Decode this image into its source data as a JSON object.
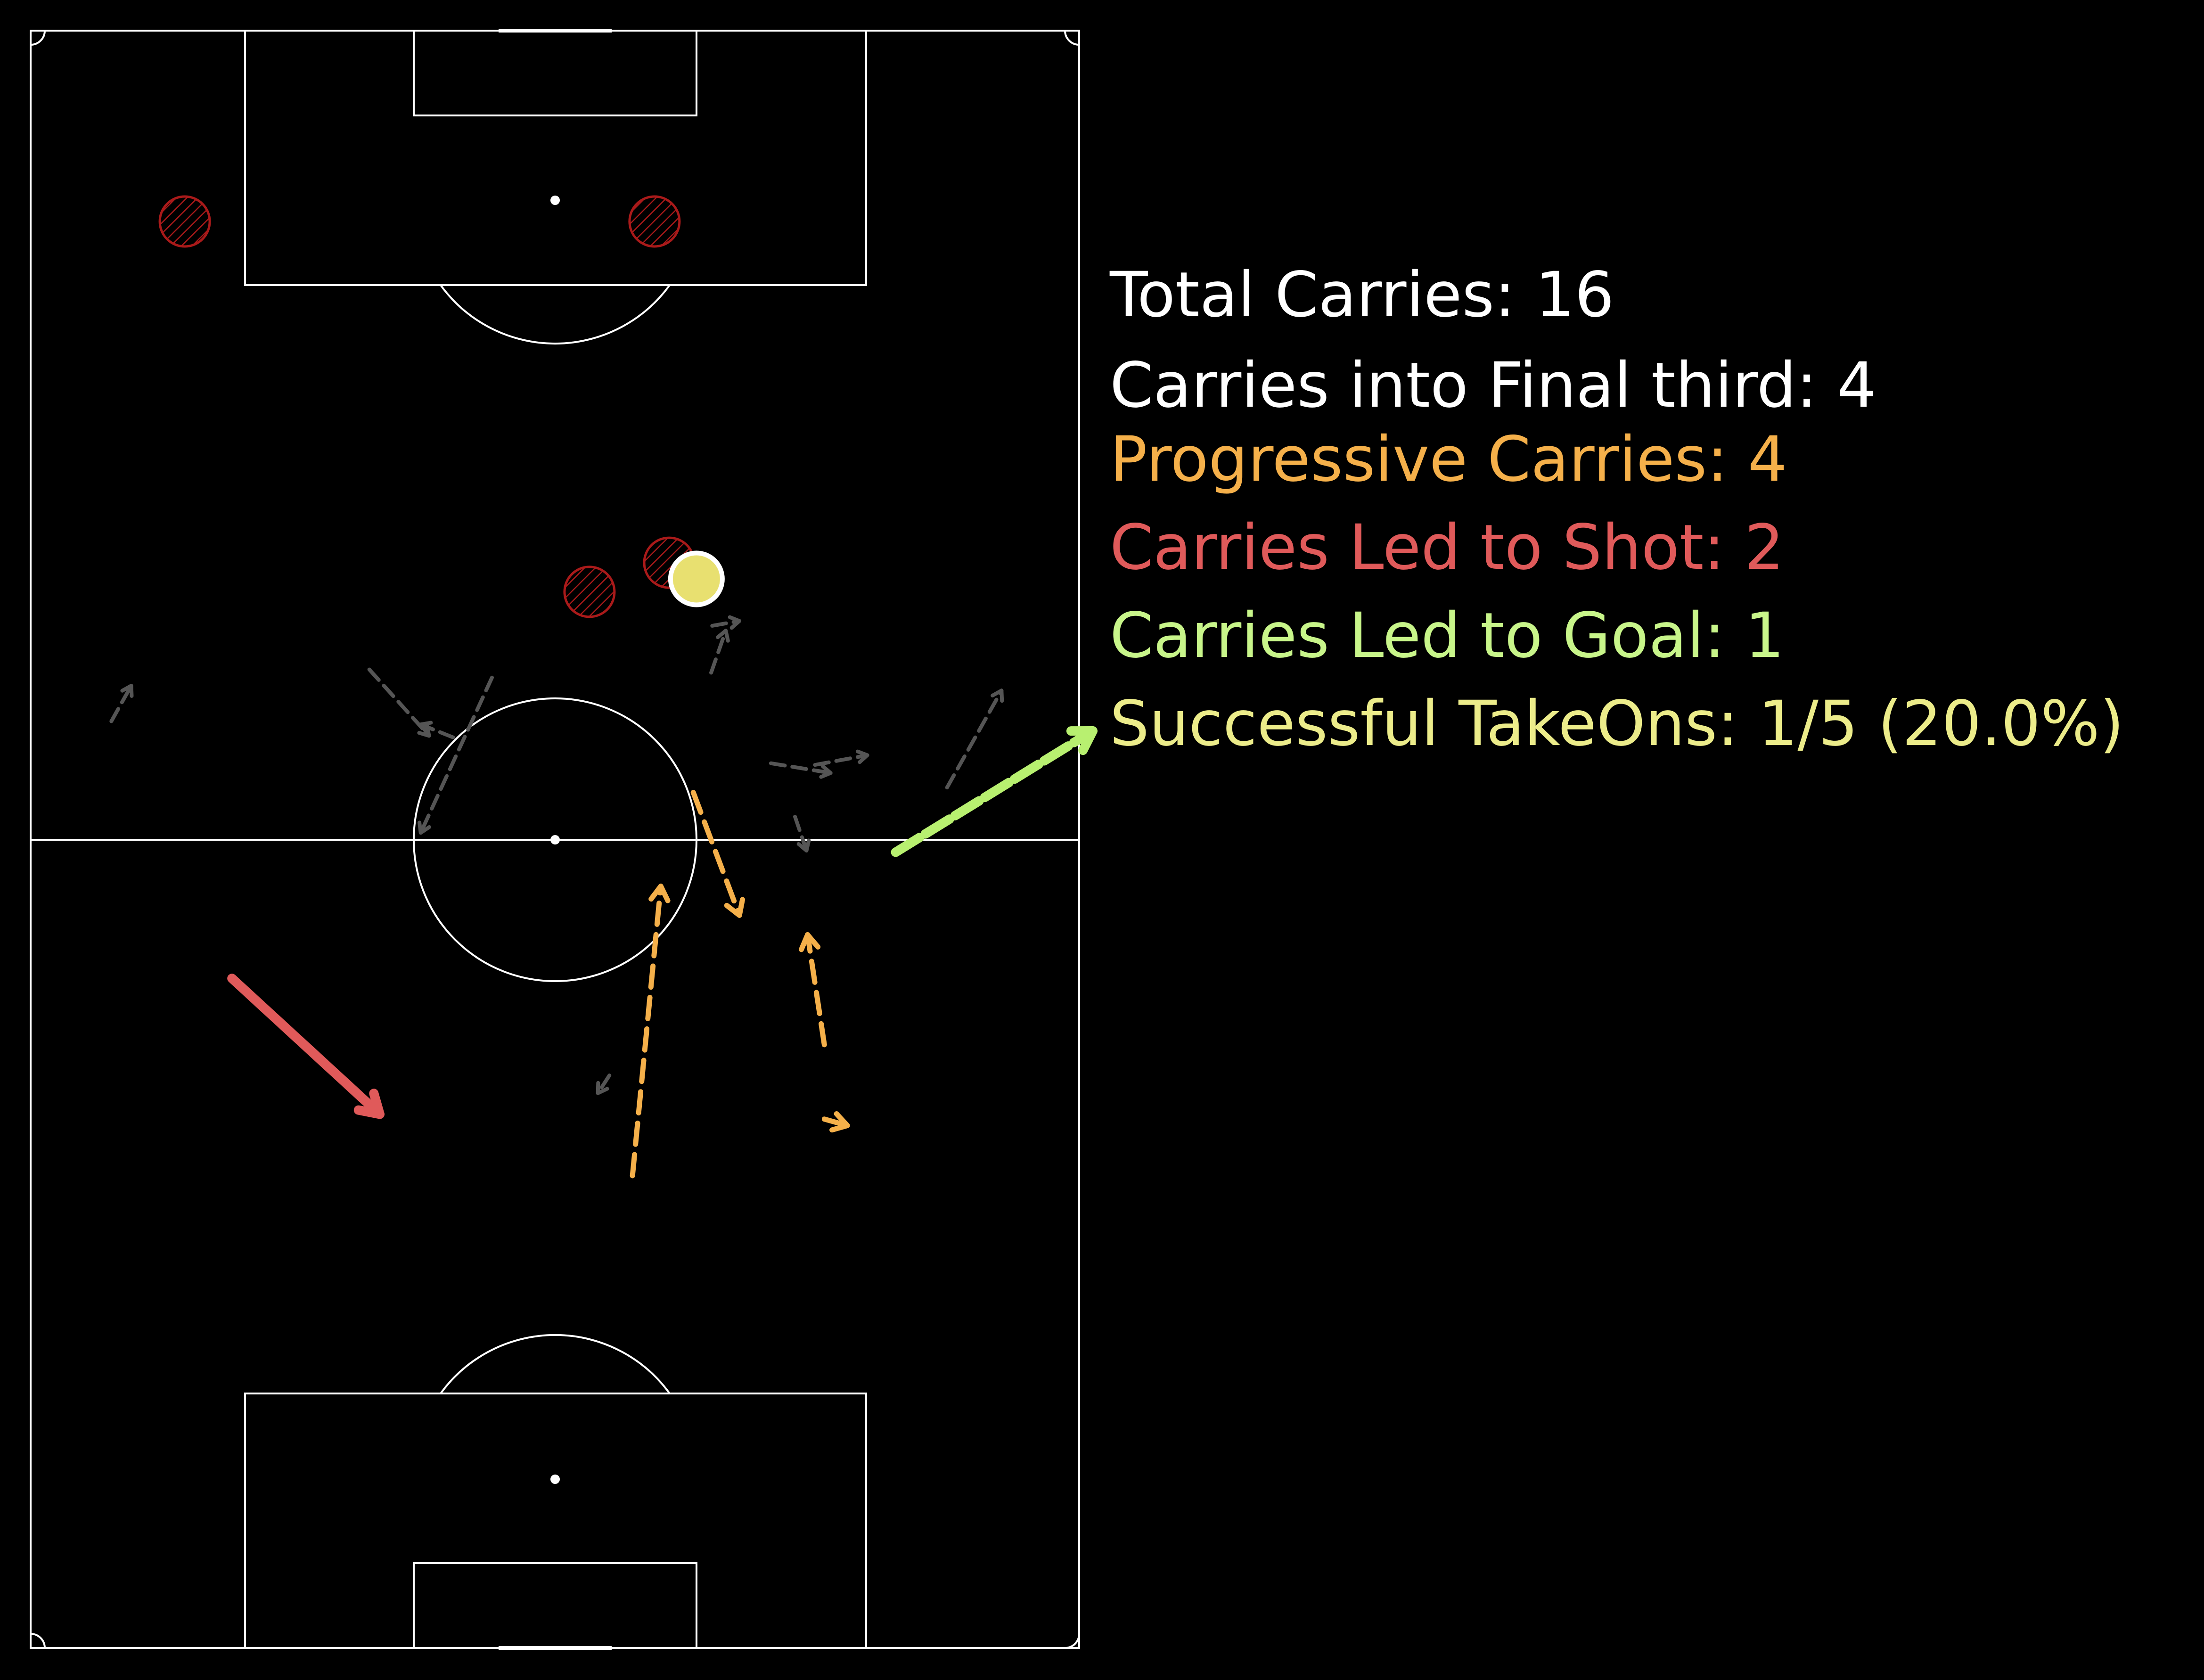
{
  "colors": {
    "background": "#000000",
    "pitch_line": "#ffffff",
    "total": "#ffffff",
    "final_third": "#ffffff",
    "progressive": "#f5b04a",
    "led_to_shot": "#e05a5a",
    "led_to_goal": "#c8f58a",
    "takeons": "#ecec8a",
    "other_carry": "#555555",
    "failed_takeon": "#aa1a1a",
    "successful_takeon": "#e8e070",
    "goal_carry_arrow": "#b8f070"
  },
  "stats": {
    "total_carries": "Total Carries: 16",
    "final_third": "Carries into Final third: 4",
    "progressive": "Progressive Carries: 4",
    "led_to_shot": "Carries Led to Shot: 2",
    "led_to_goal": "Carries Led to Goal: 1",
    "takeons": "Successful TakeOns: 1/5 (20.0%)"
  },
  "carries": [
    {
      "type": "goal",
      "x1": 49.2,
      "y1": 82.5,
      "x2": 56.7,
      "y2": 101.3
    },
    {
      "type": "shot",
      "x1": 41.4,
      "y1": 19.2,
      "x2": 33.0,
      "y2": 33.3
    },
    {
      "type": "progressive",
      "x1": 52.9,
      "y1": 63.2,
      "x2": 45.3,
      "y2": 67.6
    },
    {
      "type": "progressive",
      "x1": 37.3,
      "y1": 75.7,
      "x2": 44.1,
      "y2": 74.1
    },
    {
      "type": "progressive",
      "x1": 32.7,
      "y1": 75.7,
      "x2": 32.3,
      "y2": 77.9
    },
    {
      "type": "progressive",
      "x1": 29.2,
      "y1": 57.4,
      "x2": 47.1,
      "y2": 60.1
    },
    {
      "type": "other",
      "x1": 53.2,
      "y1": 87.4,
      "x2": 59.2,
      "y2": 92.6
    },
    {
      "type": "other",
      "x1": 54.6,
      "y1": 74.8,
      "x2": 55.2,
      "y2": 79.8
    },
    {
      "type": "other",
      "x1": 54.7,
      "y1": 70.6,
      "x2": 54.1,
      "y2": 76.3
    },
    {
      "type": "other",
      "x1": 51.4,
      "y1": 72.9,
      "x2": 49.3,
      "y2": 74.0
    },
    {
      "type": "other",
      "x1": 60.3,
      "y1": 64.9,
      "x2": 62.9,
      "y2": 66.3
    },
    {
      "type": "other",
      "x1": 60.5,
      "y1": 32.3,
      "x2": 56.4,
      "y2": 38.0
    },
    {
      "type": "other",
      "x1": 63.2,
      "y1": 65.0,
      "x2": 63.5,
      "y2": 67.6
    },
    {
      "type": "other",
      "x1": 60.0,
      "y1": 44.0,
      "x2": 50.4,
      "y2": 37.2
    },
    {
      "type": "other",
      "x1": 57.3,
      "y1": 7.7,
      "x2": 59.5,
      "y2": 9.6
    },
    {
      "type": "other",
      "x1": 56.3,
      "y1": 40.3,
      "x2": 57.1,
      "y2": 37.2
    },
    {
      "type": "other",
      "x1": 35.4,
      "y1": 55.2,
      "x2": 34.3,
      "y2": 54.1
    }
  ],
  "takeons": [
    {
      "success": false,
      "x": 88.2,
      "y": 14.7
    },
    {
      "success": false,
      "x": 88.2,
      "y": 59.5
    },
    {
      "success": false,
      "x": 65.3,
      "y": 53.3
    },
    {
      "success": false,
      "x": 67.1,
      "y": 60.9
    },
    {
      "success": true,
      "x": 66.1,
      "y": 63.5
    }
  ]
}
